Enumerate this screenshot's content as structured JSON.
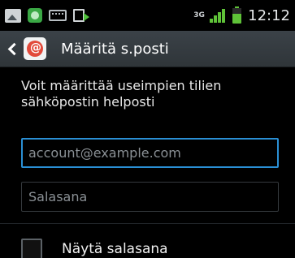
{
  "status_bar": {
    "left_icons": [
      "gallery-icon",
      "play-store-icon",
      "keyboard-icon",
      "usb-icon"
    ],
    "network_type": "3G",
    "time": "12:12",
    "colors": {
      "signal": "#5fc238",
      "battery": "#5fc238"
    }
  },
  "action_bar": {
    "title": "Määritä s.posti",
    "back_icon": "chevron-left-icon",
    "app_icon": "email-app-icon"
  },
  "form": {
    "description": "Voit määrittää useimpien tilien sähköpostin helposti",
    "email": {
      "value": "",
      "placeholder": "account@example.com"
    },
    "password": {
      "value": "",
      "placeholder": "Salasana"
    },
    "show_password": {
      "label": "Näytä salasana",
      "checked": false
    }
  },
  "colors": {
    "accent": "#2a8fd4",
    "background": "#000000",
    "actionbar": "#353b40"
  }
}
